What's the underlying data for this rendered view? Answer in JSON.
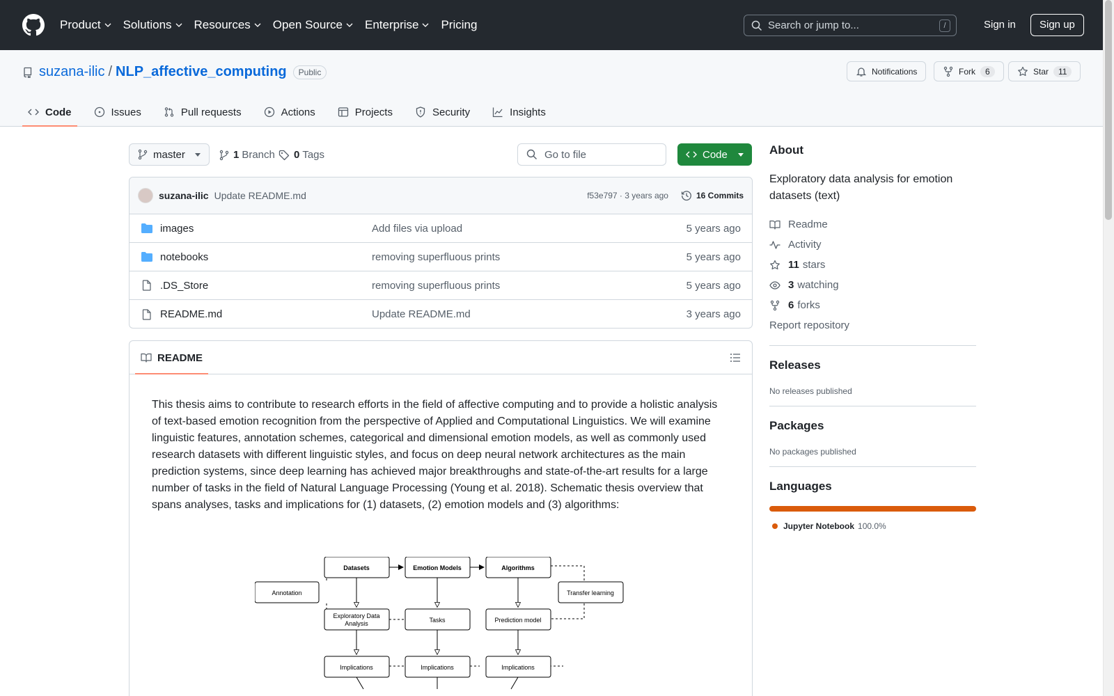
{
  "header": {
    "nav": [
      {
        "label": "Product",
        "dropdown": true
      },
      {
        "label": "Solutions",
        "dropdown": true
      },
      {
        "label": "Resources",
        "dropdown": true
      },
      {
        "label": "Open Source",
        "dropdown": true
      },
      {
        "label": "Enterprise",
        "dropdown": true
      },
      {
        "label": "Pricing",
        "dropdown": false
      }
    ],
    "search_placeholder": "Search or jump to...",
    "search_shortcut": "/",
    "sign_in": "Sign in",
    "sign_up": "Sign up"
  },
  "repo": {
    "owner": "suzana-ilic",
    "separator": "/",
    "name": "NLP_affective_computing",
    "visibility": "Public",
    "notifications_label": "Notifications",
    "fork_label": "Fork",
    "fork_count": "6",
    "star_label": "Star",
    "star_count": "11"
  },
  "tabs": [
    {
      "label": "Code",
      "icon": "code-icon",
      "active": true
    },
    {
      "label": "Issues",
      "icon": "issue-icon",
      "active": false
    },
    {
      "label": "Pull requests",
      "icon": "pull-request-icon",
      "active": false
    },
    {
      "label": "Actions",
      "icon": "play-icon",
      "active": false
    },
    {
      "label": "Projects",
      "icon": "table-icon",
      "active": false
    },
    {
      "label": "Security",
      "icon": "shield-icon",
      "active": false
    },
    {
      "label": "Insights",
      "icon": "graph-icon",
      "active": false
    }
  ],
  "toolbar": {
    "branch": "master",
    "branch_count": "1",
    "branch_label": "Branch",
    "tag_count": "0",
    "tag_label": "Tags",
    "go_to_file": "Go to file",
    "code_label": "Code"
  },
  "latest_commit": {
    "user": "suzana-ilic",
    "message": "Update README.md",
    "hash_time": "f53e797 · 3 years ago",
    "commits": "16 Commits"
  },
  "files": [
    {
      "name": "images",
      "type": "folder",
      "message": "Add files via upload",
      "date": "5 years ago"
    },
    {
      "name": "notebooks",
      "type": "folder",
      "message": "removing superfluous prints",
      "date": "5 years ago"
    },
    {
      "name": ".DS_Store",
      "type": "file",
      "message": "removing superfluous prints",
      "date": "5 years ago"
    },
    {
      "name": "README.md",
      "type": "file",
      "message": "Update README.md",
      "date": "3 years ago"
    }
  ],
  "readme": {
    "tab": "README",
    "text": "This thesis aims to contribute to research efforts in the field of affective computing and to provide a holistic analysis of text-based emotion recognition from the perspective of Applied and Computational Linguistics. We will examine linguistic features, annotation schemes, categorical and dimensional emotion models, as well as commonly used research datasets with different linguistic styles, and focus on deep neural network architectures as the main prediction systems, since deep learning has achieved major breakthroughs and state-of-the-art results for a large number of tasks in the field of Natural Language Processing (Young et al. 2018). Schematic thesis overview that spans analyses, tasks and implications for (1) datasets, (2) emotion models and (3) algorithms:",
    "diagram": {
      "datasets": "Datasets",
      "emotion_models": "Emotion Models",
      "algorithms": "Algorithms",
      "annotation": "Annotation",
      "transfer_learning": "Transfer learning",
      "eda_line1": "Exploratory Data",
      "eda_line2": "Analysis",
      "tasks": "Tasks",
      "prediction_model": "Prediction model",
      "implications": "Implications"
    }
  },
  "about": {
    "heading": "About",
    "description": "Exploratory data analysis for emotion datasets (text)",
    "readme": "Readme",
    "activity": "Activity",
    "stars_count": "11",
    "stars_label": "stars",
    "watching_count": "3",
    "watching_label": "watching",
    "forks_count": "6",
    "forks_label": "forks",
    "report": "Report repository"
  },
  "releases": {
    "heading": "Releases",
    "text": "No releases published"
  },
  "packages": {
    "heading": "Packages",
    "text": "No packages published"
  },
  "languages": {
    "heading": "Languages",
    "items": [
      {
        "name": "Jupyter Notebook",
        "percent": "100.0%",
        "color": "#da5b0b"
      }
    ]
  }
}
